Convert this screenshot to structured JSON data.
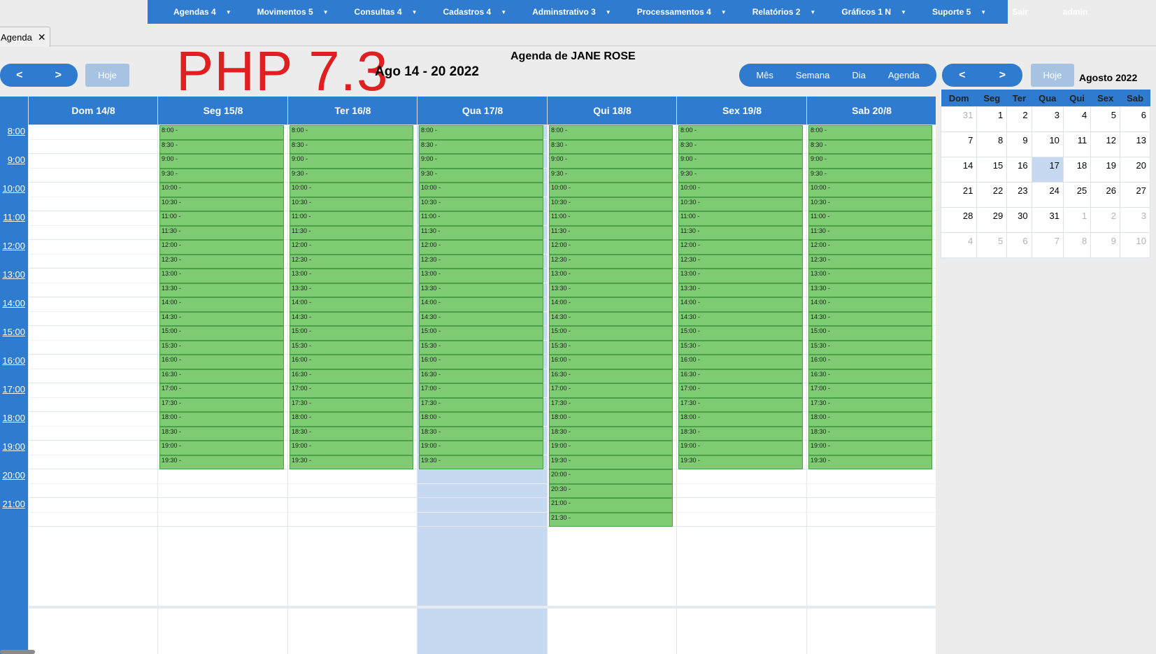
{
  "nav": {
    "items": [
      {
        "label": "Agendas 4",
        "caret": true
      },
      {
        "label": "Movimentos 5",
        "caret": true
      },
      {
        "label": "Consultas 4",
        "caret": true
      },
      {
        "label": "Cadastros 4",
        "caret": true
      },
      {
        "label": "Adminstrativo 3",
        "caret": true
      },
      {
        "label": "Processamentos 4",
        "caret": true
      },
      {
        "label": "Relatórios 2",
        "caret": true
      },
      {
        "label": "Gráficos 1 N",
        "caret": true
      },
      {
        "label": "Suporte 5",
        "caret": true
      },
      {
        "label": "Sair",
        "caret": false
      },
      {
        "label": "admin",
        "caret": false
      }
    ],
    "caret_glyph": "▼"
  },
  "tab": {
    "label": "Agenda",
    "close": "✕"
  },
  "toolbar": {
    "prev": "<",
    "next": ">",
    "today_label": "Hoje",
    "range_title": "Ago 14 - 20 2022",
    "agenda_title": "Agenda de JANE ROSE",
    "views": [
      "Mês",
      "Semana",
      "Dia",
      "Agenda"
    ]
  },
  "watermark": "PHP 7.3",
  "calendar": {
    "days": [
      "Dom 14/8",
      "Seg 15/8",
      "Ter 16/8",
      "Qua 17/8",
      "Qui 18/8",
      "Sex 19/8",
      "Sab 20/8"
    ],
    "today_index": 3,
    "hours": [
      "8:00",
      "9:00",
      "10:00",
      "11:00",
      "12:00",
      "13:00",
      "14:00",
      "15:00",
      "16:00",
      "17:00",
      "18:00",
      "19:00",
      "20:00",
      "21:00"
    ],
    "slot_times": [
      "8:00 -",
      "8:30 -",
      "9:00 -",
      "9:30 -",
      "10:00 -",
      "10:30 -",
      "11:00 -",
      "11:30 -",
      "12:00 -",
      "12:30 -",
      "13:00 -",
      "13:30 -",
      "14:00 -",
      "14:30 -",
      "15:00 -",
      "15:30 -",
      "16:00 -",
      "16:30 -",
      "17:00 -",
      "17:30 -",
      "18:00 -",
      "18:30 -",
      "19:00 -",
      "19:30 -",
      "20:00 -",
      "20:30 -",
      "21:00 -",
      "21:30 -"
    ],
    "slot_counts": [
      0,
      24,
      24,
      24,
      28,
      24,
      24
    ]
  },
  "mini_calendar": {
    "prev": "<",
    "next": ">",
    "today_label": "Hoje",
    "title": "Agosto 2022",
    "weekdays": [
      "Dom",
      "Seg",
      "Ter",
      "Qua",
      "Qui",
      "Sex",
      "Sab"
    ],
    "weeks": [
      [
        {
          "d": "31",
          "o": true
        },
        {
          "d": "1"
        },
        {
          "d": "2"
        },
        {
          "d": "3"
        },
        {
          "d": "4"
        },
        {
          "d": "5"
        },
        {
          "d": "6"
        }
      ],
      [
        {
          "d": "7"
        },
        {
          "d": "8"
        },
        {
          "d": "9"
        },
        {
          "d": "10"
        },
        {
          "d": "11"
        },
        {
          "d": "12"
        },
        {
          "d": "13"
        }
      ],
      [
        {
          "d": "14"
        },
        {
          "d": "15"
        },
        {
          "d": "16"
        },
        {
          "d": "17",
          "t": true
        },
        {
          "d": "18"
        },
        {
          "d": "19"
        },
        {
          "d": "20"
        }
      ],
      [
        {
          "d": "21"
        },
        {
          "d": "22"
        },
        {
          "d": "23"
        },
        {
          "d": "24"
        },
        {
          "d": "25"
        },
        {
          "d": "26"
        },
        {
          "d": "27"
        }
      ],
      [
        {
          "d": "28"
        },
        {
          "d": "29"
        },
        {
          "d": "30"
        },
        {
          "d": "31"
        },
        {
          "d": "1",
          "o": true
        },
        {
          "d": "2",
          "o": true
        },
        {
          "d": "3",
          "o": true
        }
      ],
      [
        {
          "d": "4",
          "o": true
        },
        {
          "d": "5",
          "o": true
        },
        {
          "d": "6",
          "o": true
        },
        {
          "d": "7",
          "o": true
        },
        {
          "d": "8",
          "o": true
        },
        {
          "d": "9",
          "o": true
        },
        {
          "d": "10",
          "o": true
        }
      ]
    ]
  }
}
